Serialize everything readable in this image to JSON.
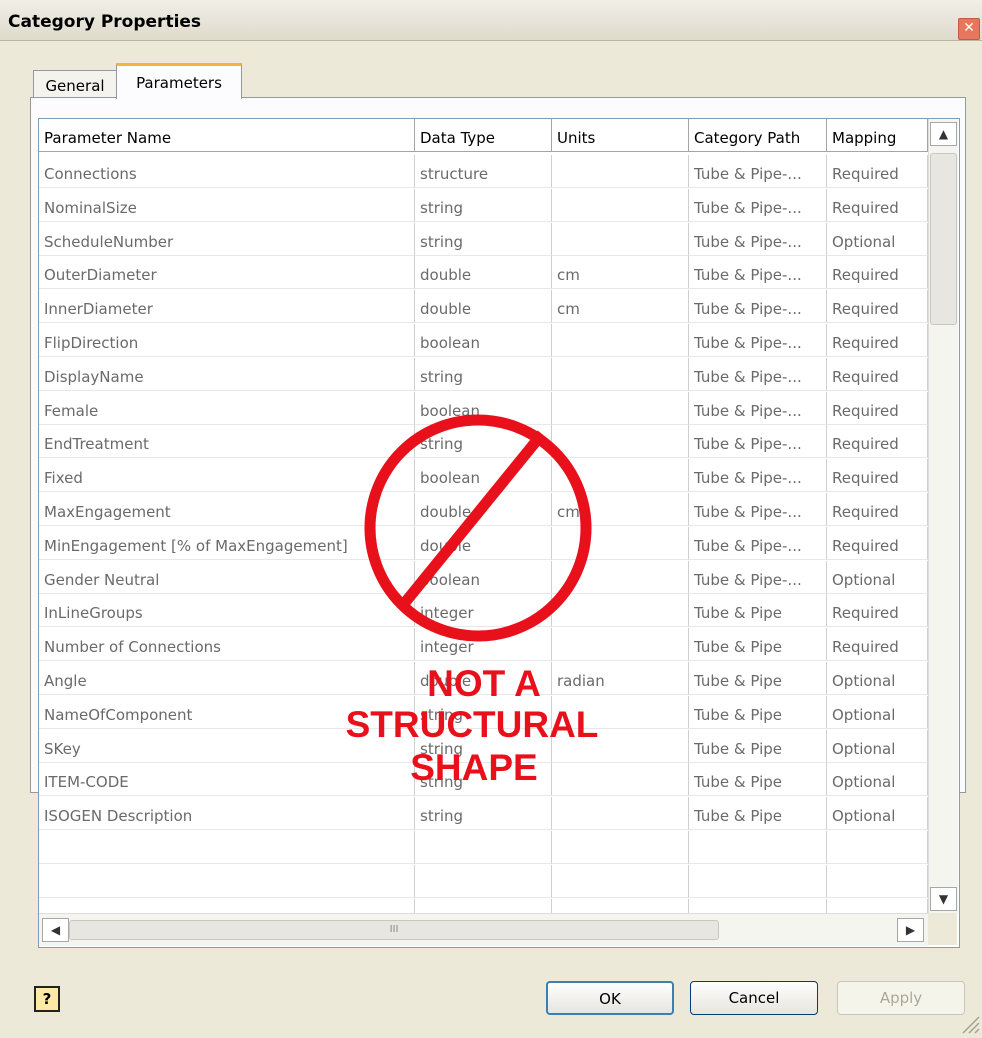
{
  "window": {
    "title": "Category Properties"
  },
  "tabs": [
    {
      "label": "General"
    },
    {
      "label": "Parameters"
    }
  ],
  "table": {
    "columns": [
      "Parameter Name",
      "Data Type",
      "Units",
      "Category Path",
      "Mapping"
    ],
    "rows": [
      [
        "Connections",
        "structure",
        "",
        "Tube & Pipe-...",
        "Required"
      ],
      [
        "NominalSize",
        "string",
        "",
        "Tube & Pipe-...",
        "Required"
      ],
      [
        "ScheduleNumber",
        "string",
        "",
        "Tube & Pipe-...",
        "Optional"
      ],
      [
        "OuterDiameter",
        "double",
        "cm",
        "Tube & Pipe-...",
        "Required"
      ],
      [
        "InnerDiameter",
        "double",
        "cm",
        "Tube & Pipe-...",
        "Required"
      ],
      [
        "FlipDirection",
        "boolean",
        "",
        "Tube & Pipe-...",
        "Required"
      ],
      [
        "DisplayName",
        "string",
        "",
        "Tube & Pipe-...",
        "Required"
      ],
      [
        "Female",
        "boolean",
        "",
        "Tube & Pipe-...",
        "Required"
      ],
      [
        "EndTreatment",
        "string",
        "",
        "Tube & Pipe-...",
        "Required"
      ],
      [
        "Fixed",
        "boolean",
        "",
        "Tube & Pipe-...",
        "Required"
      ],
      [
        "MaxEngagement",
        "double",
        "cm",
        "Tube & Pipe-...",
        "Required"
      ],
      [
        "MinEngagement [% of MaxEngagement]",
        "double",
        "",
        "Tube & Pipe-...",
        "Required"
      ],
      [
        "Gender Neutral",
        "boolean",
        "",
        "Tube & Pipe-...",
        "Optional"
      ],
      [
        "InLineGroups",
        "integer",
        "",
        "Tube & Pipe",
        "Required"
      ],
      [
        "Number of Connections",
        "integer",
        "",
        "Tube & Pipe",
        "Required"
      ],
      [
        "Angle",
        "double",
        "radian",
        "Tube & Pipe",
        "Optional"
      ],
      [
        "NameOfComponent",
        "string",
        "",
        "Tube & Pipe",
        "Optional"
      ],
      [
        "SKey",
        "string",
        "",
        "Tube & Pipe",
        "Optional"
      ],
      [
        "ITEM-CODE",
        "string",
        "",
        "Tube & Pipe",
        "Optional"
      ],
      [
        "ISOGEN Description",
        "string",
        "",
        "Tube & Pipe",
        "Optional"
      ],
      [
        "",
        "",
        "",
        "",
        ""
      ],
      [
        "",
        "",
        "",
        "",
        ""
      ],
      [
        "",
        "",
        "",
        "",
        ""
      ]
    ]
  },
  "annotation": {
    "line1": "NOT A",
    "line2": "STRUCTURAL",
    "line3": "SHAPE",
    "color": "#e8101b"
  },
  "buttons": {
    "help": "?",
    "ok": "OK",
    "cancel": "Cancel",
    "apply": "Apply"
  },
  "scroll": {
    "hthumb_glyph": "III"
  }
}
